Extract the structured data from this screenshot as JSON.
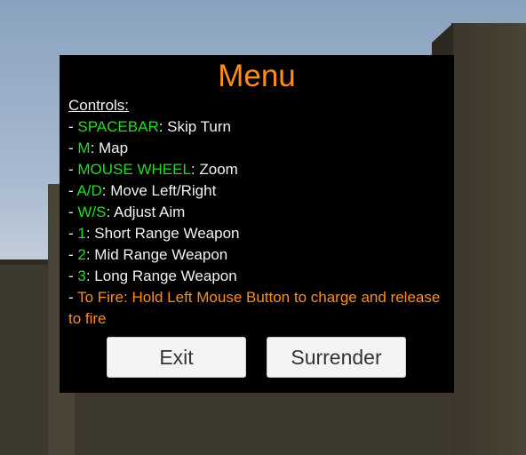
{
  "menu": {
    "title": "Menu",
    "controls_header": "Controls:",
    "controls": [
      {
        "prefix": "- ",
        "key": "SPACEBAR",
        "desc": ": Skip Turn"
      },
      {
        "prefix": "- ",
        "key": "M",
        "desc": ": Map"
      },
      {
        "prefix": "- ",
        "key": "MOUSE WHEEL",
        "desc": ": Zoom"
      },
      {
        "prefix": "- ",
        "key": "A/D",
        "desc": ": Move Left/Right"
      },
      {
        "prefix": "- ",
        "key": "W/S",
        "desc": ": Adjust Aim"
      },
      {
        "prefix": "- ",
        "key": "1",
        "desc": ": Short Range Weapon"
      },
      {
        "prefix": "- ",
        "key": "2",
        "desc": ": Mid Range Weapon"
      },
      {
        "prefix": "- ",
        "key": "3",
        "desc": ": Long Range Weapon"
      }
    ],
    "fire_prefix": "- ",
    "fire_hint": "To Fire: Hold Left Mouse Button to charge and release to fire",
    "buttons": {
      "exit": "Exit",
      "surrender": "Surrender"
    }
  },
  "colors": {
    "title": "#ff8c1a",
    "key": "#22dd22",
    "text": "#f2f2f2",
    "panel": "#000000"
  }
}
